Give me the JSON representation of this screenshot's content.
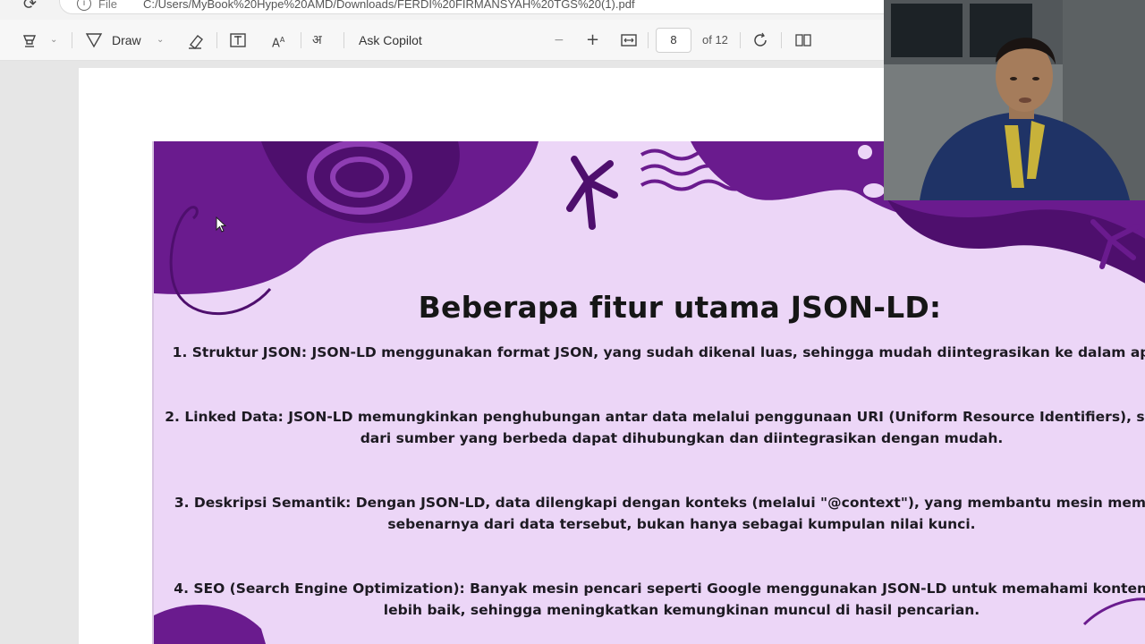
{
  "address_bar": {
    "file_label": "File",
    "url": "C:/Users/MyBook%20Hype%20AMD/Downloads/FERDI%20FIRMANSYAH%20TGS%20(1).pdf"
  },
  "toolbar": {
    "draw_label": "Draw",
    "ask_copilot_label": "Ask Copilot",
    "zoom_out_symbol": "−",
    "zoom_in_symbol": "+",
    "current_page": "8",
    "page_total": "of 12"
  },
  "slide": {
    "title": "Beberapa fitur utama JSON-LD:",
    "points": [
      {
        "line1": "1. Struktur JSON: JSON-LD menggunakan format JSON, yang sudah dikenal luas, sehingga mudah diintegrasikan ke dalam aplikasi",
        "line2": ""
      },
      {
        "line1": "2. Linked Data: JSON-LD memungkinkan penghubungan antar data melalui penggunaan URI (Uniform Resource Identifiers), sehingg",
        "line2": "dari sumber yang berbeda dapat dihubungkan dan diintegrasikan dengan mudah."
      },
      {
        "line1": "3. Deskripsi Semantik: Dengan JSON-LD, data dilengkapi dengan konteks (melalui \"@context\"), yang membantu mesin memaham",
        "line2": "sebenarnya dari data tersebut, bukan hanya sebagai kumpulan nilai kunci."
      },
      {
        "line1": "4. SEO (Search Engine Optimization): Banyak mesin pencari seperti Google menggunakan JSON-LD untuk memahami konten situs",
        "line2": "lebih baik, sehingga meningkatkan kemungkinan muncul di hasil pencarian."
      }
    ]
  },
  "colors": {
    "slide_background": "#ecd6f7",
    "deco_purple": "#6a1b8e",
    "deco_purple_dark": "#4e0f6d"
  },
  "icons": [
    "reload-icon",
    "info-icon",
    "highlight-icon",
    "draw-icon",
    "eraser-icon",
    "text-box-icon",
    "text-size-icon",
    "read-aloud-icon",
    "fit-width-icon",
    "rotate-icon",
    "two-page-icon"
  ]
}
